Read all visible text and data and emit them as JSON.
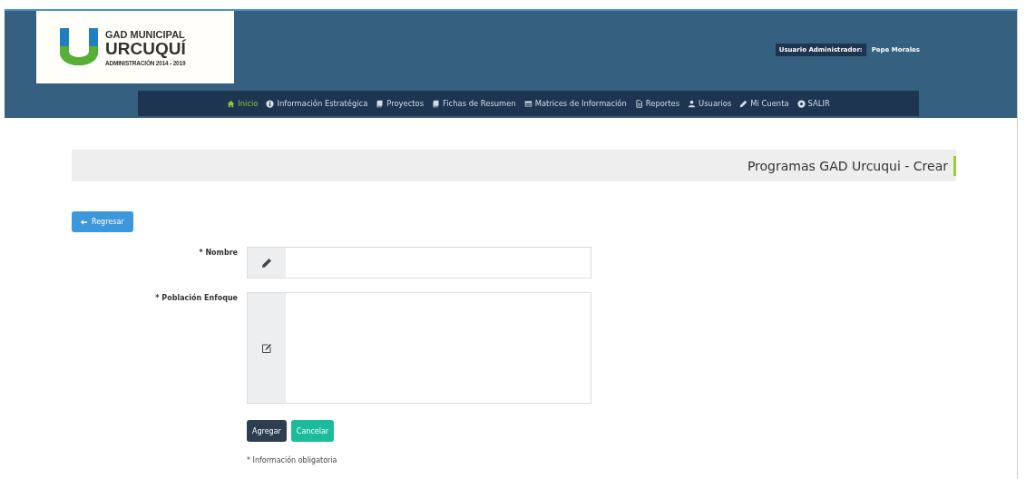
{
  "header": {
    "logo": {
      "line_1": "GAD MUNICIPAL",
      "line_2": "URCUQUÍ",
      "line_3": "ADMINISTRACIÓN 2014 - 2019"
    },
    "user_role": "Usuario Administrador:",
    "user_name": "Pepe Morales"
  },
  "nav": [
    {
      "label": "Inicio",
      "kind": "home",
      "selected": true
    },
    {
      "label": "Información Estratégica",
      "kind": "info",
      "selected": false
    },
    {
      "label": "Proyectos",
      "kind": "book",
      "selected": false
    },
    {
      "label": "Fichas de Resumen",
      "kind": "book",
      "selected": false
    },
    {
      "label": "Matrices de Información",
      "kind": "table",
      "selected": false
    },
    {
      "label": "Reportes",
      "kind": "file",
      "selected": false
    },
    {
      "label": "Usuarios",
      "kind": "user",
      "selected": false
    },
    {
      "label": "Mi Cuenta",
      "kind": "pencil",
      "selected": false
    },
    {
      "label": "SALIR",
      "kind": "power",
      "selected": false
    }
  ],
  "page_title": "Programas GAD Urcuqui - Crear",
  "back_button": "Regresar",
  "form": {
    "fields": [
      {
        "label": "* Nombre",
        "kind": "input"
      },
      {
        "label": "* Población Enfoque",
        "kind": "textarea"
      }
    ],
    "buttons": [
      {
        "label": "Agregar",
        "kind": "primary"
      },
      {
        "label": "Cancelar",
        "kind": "secondary"
      }
    ],
    "note": "* Información obligatoria"
  }
}
